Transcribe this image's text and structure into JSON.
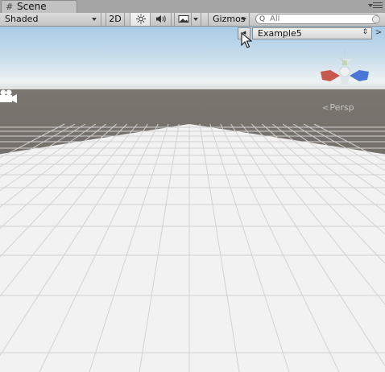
{
  "tab": {
    "title": "Scene"
  },
  "toolbar": {
    "draw_mode": "Shaded",
    "btn_2d": "2D",
    "gizmos": "Gizmos",
    "search_placeholder": "All"
  },
  "overlay": {
    "selected": "Example5",
    "left_arrow": "◂",
    "right_arrow": ">"
  },
  "view": {
    "projection": "Persp"
  },
  "icons": {
    "hash": "grid-hash-icon",
    "lighting": "sun-icon",
    "audio": "speaker-icon",
    "effects": "image-icon",
    "search": "magnifier-icon",
    "camera": "camera-icon",
    "cursor": "mouse-pointer-icon"
  },
  "colors": {
    "sky_top": "#aecfe6",
    "sky_horizon": "#e8eef2",
    "ground": "#6d6864",
    "floor": "#f3f3f3",
    "grid_line": "#d0d0d0",
    "gizmo_x": "#d9493a",
    "gizmo_z": "#3c6ed8",
    "gizmo_y": "#9acc2e"
  }
}
